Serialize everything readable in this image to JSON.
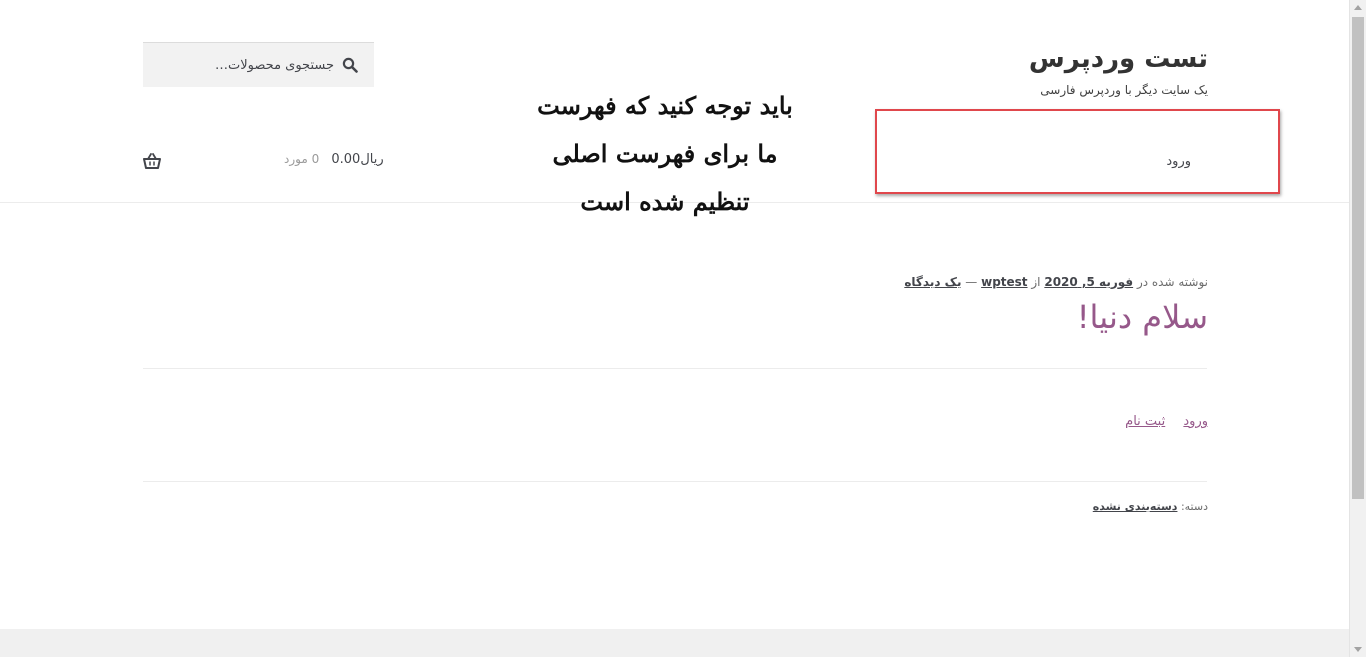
{
  "header": {
    "site_title": "تست وردپرس",
    "site_description": "یک سایت دیگر با وردپرس فارسی",
    "search_placeholder": "جستجوی محصولات…",
    "nav_login": "ورود",
    "cart_amount": "ریال0.00",
    "cart_count": "0 مورد"
  },
  "annotation": {
    "line1": "باید توجه کنید که فهرست",
    "line2": "ما برای فهرست اصلی",
    "line3": "تنظیم شده است"
  },
  "post": {
    "meta_prefix": "نوشته شده در",
    "date": "فوریه 5, 2020",
    "by": "از",
    "author": "wptest",
    "separator": "—",
    "comment_link": "یک دیدگاه",
    "title": "سلام دنیا!",
    "link_login": "ورود",
    "link_register": "ثبت نام",
    "category_label": "دسته:",
    "category": "دسته‌بندی نشده"
  },
  "colors": {
    "accent": "#96588a",
    "annotation_border": "#e0474c"
  }
}
